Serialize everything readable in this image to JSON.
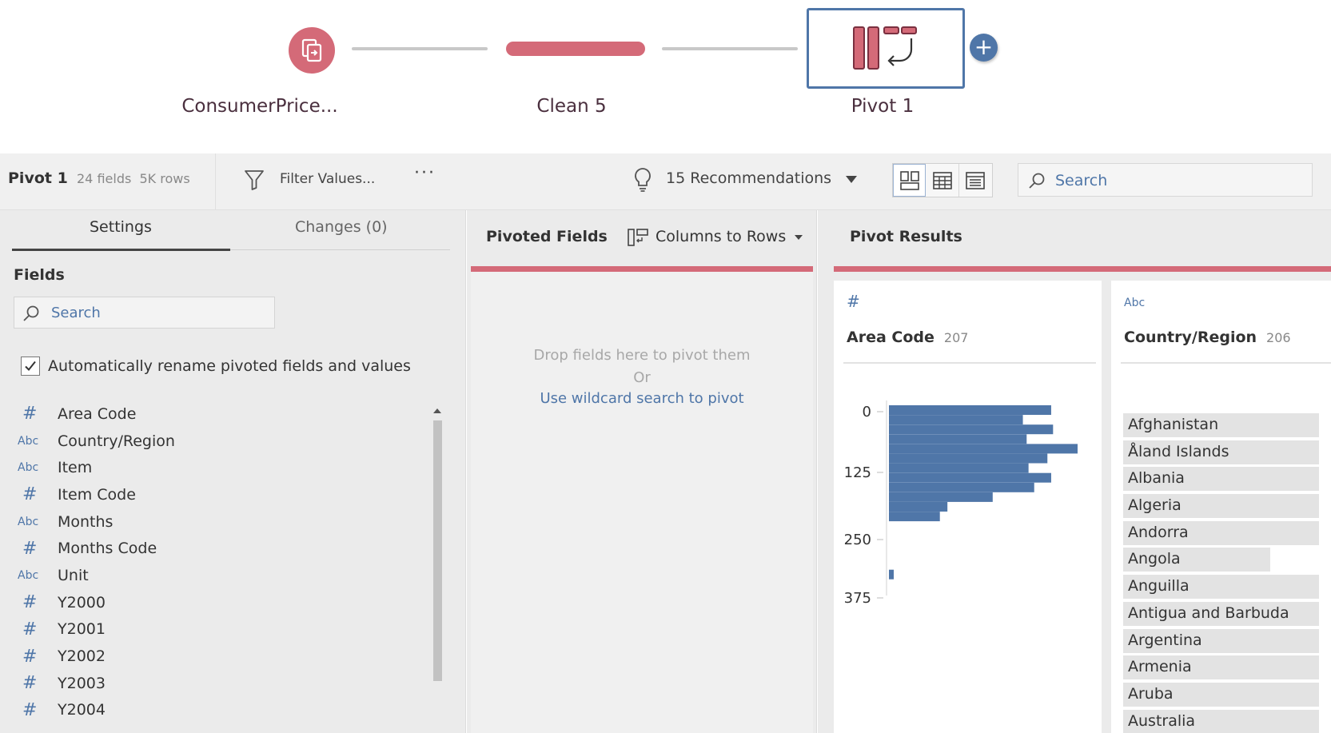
{
  "flow": {
    "nodes": [
      {
        "label": "ConsumerPrice..."
      },
      {
        "label": "Clean 5"
      },
      {
        "label": "Pivot 1"
      }
    ],
    "add_label": "+"
  },
  "toolbar": {
    "title": "Pivot 1",
    "fields_count": "24 fields",
    "rows_count": "5K rows",
    "filter_label": "Filter Values...",
    "more_label": "···",
    "recommendations": "15 Recommendations",
    "search_placeholder": "Search"
  },
  "settings": {
    "tabs": [
      {
        "label": "Settings"
      },
      {
        "label": "Changes (0)"
      }
    ],
    "fields_title": "Fields",
    "search_placeholder": "Search",
    "rename_label": "Automatically rename pivoted fields and values",
    "rename_checked": true,
    "fields": [
      {
        "type": "#",
        "name": "Area Code"
      },
      {
        "type": "Abc",
        "name": "Country/Region"
      },
      {
        "type": "Abc",
        "name": "Item"
      },
      {
        "type": "#",
        "name": "Item Code"
      },
      {
        "type": "Abc",
        "name": "Months"
      },
      {
        "type": "#",
        "name": "Months Code"
      },
      {
        "type": "Abc",
        "name": "Unit"
      },
      {
        "type": "#",
        "name": "Y2000"
      },
      {
        "type": "#",
        "name": "Y2001"
      },
      {
        "type": "#",
        "name": "Y2002"
      },
      {
        "type": "#",
        "name": "Y2003"
      },
      {
        "type": "#",
        "name": "Y2004"
      }
    ]
  },
  "pivoted": {
    "title": "Pivoted Fields",
    "mode_label": "Columns to Rows",
    "drop_hint": "Drop fields here to pivot them",
    "or_label": "Or",
    "wildcard_link": "Use wildcard search to pivot"
  },
  "results": {
    "title": "Pivot Results",
    "accent_color": "#d46a78",
    "bar_color": "#4f76a8",
    "cards": [
      {
        "type": "#",
        "name": "Area Code",
        "count": "207"
      },
      {
        "type": "Abc",
        "name": "Country/Region",
        "count": "206"
      }
    ],
    "histogram": {
      "ticks": [
        "0",
        "125",
        "250",
        "375"
      ],
      "bar_fractions": [
        0.86,
        0.71,
        0.87,
        0.73,
        1.0,
        0.84,
        0.74,
        0.86,
        0.77,
        0.55,
        0.31,
        0.27,
        0.0,
        0.0,
        0.0,
        0.0,
        0.0,
        0.02
      ]
    },
    "countries": [
      {
        "name": "Afghanistan",
        "fraction": 1.0
      },
      {
        "name": "Åland Islands",
        "fraction": 1.0
      },
      {
        "name": "Albania",
        "fraction": 1.0
      },
      {
        "name": "Algeria",
        "fraction": 1.0
      },
      {
        "name": "Andorra",
        "fraction": 1.0
      },
      {
        "name": "Angola",
        "fraction": 0.75
      },
      {
        "name": "Anguilla",
        "fraction": 1.0
      },
      {
        "name": "Antigua and Barbuda",
        "fraction": 1.0
      },
      {
        "name": "Argentina",
        "fraction": 1.0
      },
      {
        "name": "Armenia",
        "fraction": 1.0
      },
      {
        "name": "Aruba",
        "fraction": 1.0
      },
      {
        "name": "Australia",
        "fraction": 1.0
      }
    ]
  }
}
